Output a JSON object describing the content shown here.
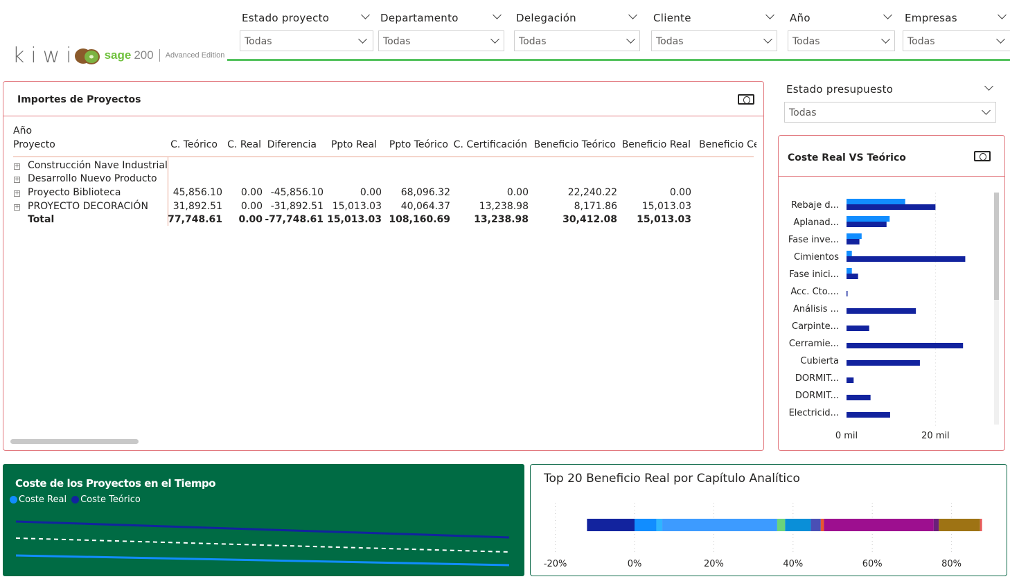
{
  "logo": {
    "kiwi_text": "kiwi",
    "sage_text": "sage",
    "sage_num": "200",
    "edition": "Advanced Edition"
  },
  "slicers": [
    {
      "title": "Estado proyecto",
      "value": "Todas"
    },
    {
      "title": "Departamento",
      "value": "Todas"
    },
    {
      "title": "Delegación",
      "value": "Todas"
    },
    {
      "title": "Cliente",
      "value": "Todas"
    },
    {
      "title": "Año",
      "value": "Todas"
    },
    {
      "title": "Empresas",
      "value": "Todas"
    }
  ],
  "estado_presupuesto": {
    "title": "Estado presupuesto",
    "value": "Todas"
  },
  "importes": {
    "title": "Importes de Proyectos",
    "header_row1": "Año",
    "header_row2": "Proyecto",
    "columns": [
      "C. Teórico",
      "C. Real",
      "Diferencia",
      "Ppto Real",
      "Ppto Teórico",
      "C. Certificación",
      "Beneficio Teórico",
      "Beneficio Real",
      "Beneficio Ce"
    ],
    "rows": [
      {
        "name": "Construcción Nave Industrial",
        "values": [
          "",
          "",
          "",
          "",
          "",
          "",
          "",
          ""
        ]
      },
      {
        "name": "Desarrollo Nuevo Producto",
        "values": [
          "",
          "",
          "",
          "",
          "",
          "",
          "",
          ""
        ]
      },
      {
        "name": "Proyecto Biblioteca",
        "values": [
          "45,856.10",
          "0.00",
          "-45,856.10",
          "0.00",
          "68,096.32",
          "0.00",
          "22,240.22",
          "0.00"
        ]
      },
      {
        "name": "PROYECTO DECORACIÓN",
        "values": [
          "31,892.51",
          "0.00",
          "-31,892.51",
          "15,013.03",
          "40,064.37",
          "13,238.98",
          "8,171.86",
          "15,013.03"
        ]
      }
    ],
    "total": {
      "name": "Total",
      "values": [
        "77,748.61",
        "0.00",
        "-77,748.61",
        "15,013.03",
        "108,160.69",
        "13,238.98",
        "30,412.08",
        "15,013.03"
      ]
    }
  },
  "coste_chart": {
    "title": "Coste Real VS Teórico",
    "x_ticks": [
      "0 mil",
      "20 mil"
    ],
    "colors": {
      "real": "#118dff",
      "teorico": "#12239e"
    },
    "chart_data": {
      "type": "bar",
      "orientation": "horizontal",
      "categories": [
        "Rebaje d...",
        "Aplanad...",
        "Fase inve...",
        "Cimientos",
        "Fase inici...",
        "Acc. Cto....",
        "Análisis ...",
        "Carpinte...",
        "Cerramie...",
        "Cubierta",
        "DORMIT...",
        "DORMIT...",
        "Electricid..."
      ],
      "series": [
        {
          "name": "Coste Real",
          "values": [
            13.2,
            9.7,
            3.4,
            1.2,
            1.2,
            0,
            0,
            0,
            0,
            0,
            0,
            0,
            0
          ]
        },
        {
          "name": "Coste Teórico",
          "values": [
            20.0,
            9.0,
            2.9,
            26.7,
            2.6,
            0.2,
            15.6,
            5.1,
            26.2,
            16.5,
            1.6,
            5.4,
            9.8
          ]
        }
      ],
      "xlim": [
        0,
        34
      ],
      "x_ticks": [
        "0 mil",
        "20 mil"
      ]
    }
  },
  "tiempo": {
    "title": "Coste de los Proyectos en el Tiempo",
    "legend": [
      {
        "label": "Coste Real",
        "color": "#118dff"
      },
      {
        "label": "Coste Teórico",
        "color": "#12239e"
      }
    ]
  },
  "top20": {
    "title": "Top 20 Beneficio Real por Capítulo Analítico",
    "x_ticks": [
      "-20%",
      "0%",
      "20%",
      "40%",
      "60%",
      "80%"
    ],
    "chart_data": {
      "type": "bar",
      "orientation": "horizontal-stacked-100",
      "xlim": [
        -0.2,
        0.88
      ],
      "segments": [
        {
          "start": -0.12,
          "end": 0.0,
          "color": "#12239e"
        },
        {
          "start": 0.0,
          "end": 0.055,
          "color": "#118dff"
        },
        {
          "start": 0.055,
          "end": 0.07,
          "color": "#2fb5ff"
        },
        {
          "start": 0.07,
          "end": 0.36,
          "color": "#3d9bff"
        },
        {
          "start": 0.36,
          "end": 0.38,
          "color": "#6bd47a"
        },
        {
          "start": 0.38,
          "end": 0.445,
          "color": "#0a8fd8"
        },
        {
          "start": 0.445,
          "end": 0.47,
          "color": "#4a4fb5"
        },
        {
          "start": 0.47,
          "end": 0.478,
          "color": "#e8572f"
        },
        {
          "start": 0.478,
          "end": 0.755,
          "color": "#9d0f8f"
        },
        {
          "start": 0.755,
          "end": 0.768,
          "color": "#6b1f7a"
        },
        {
          "start": 0.768,
          "end": 0.872,
          "color": "#9e7314"
        },
        {
          "start": 0.872,
          "end": 0.877,
          "color": "#e85a5a"
        }
      ]
    }
  }
}
